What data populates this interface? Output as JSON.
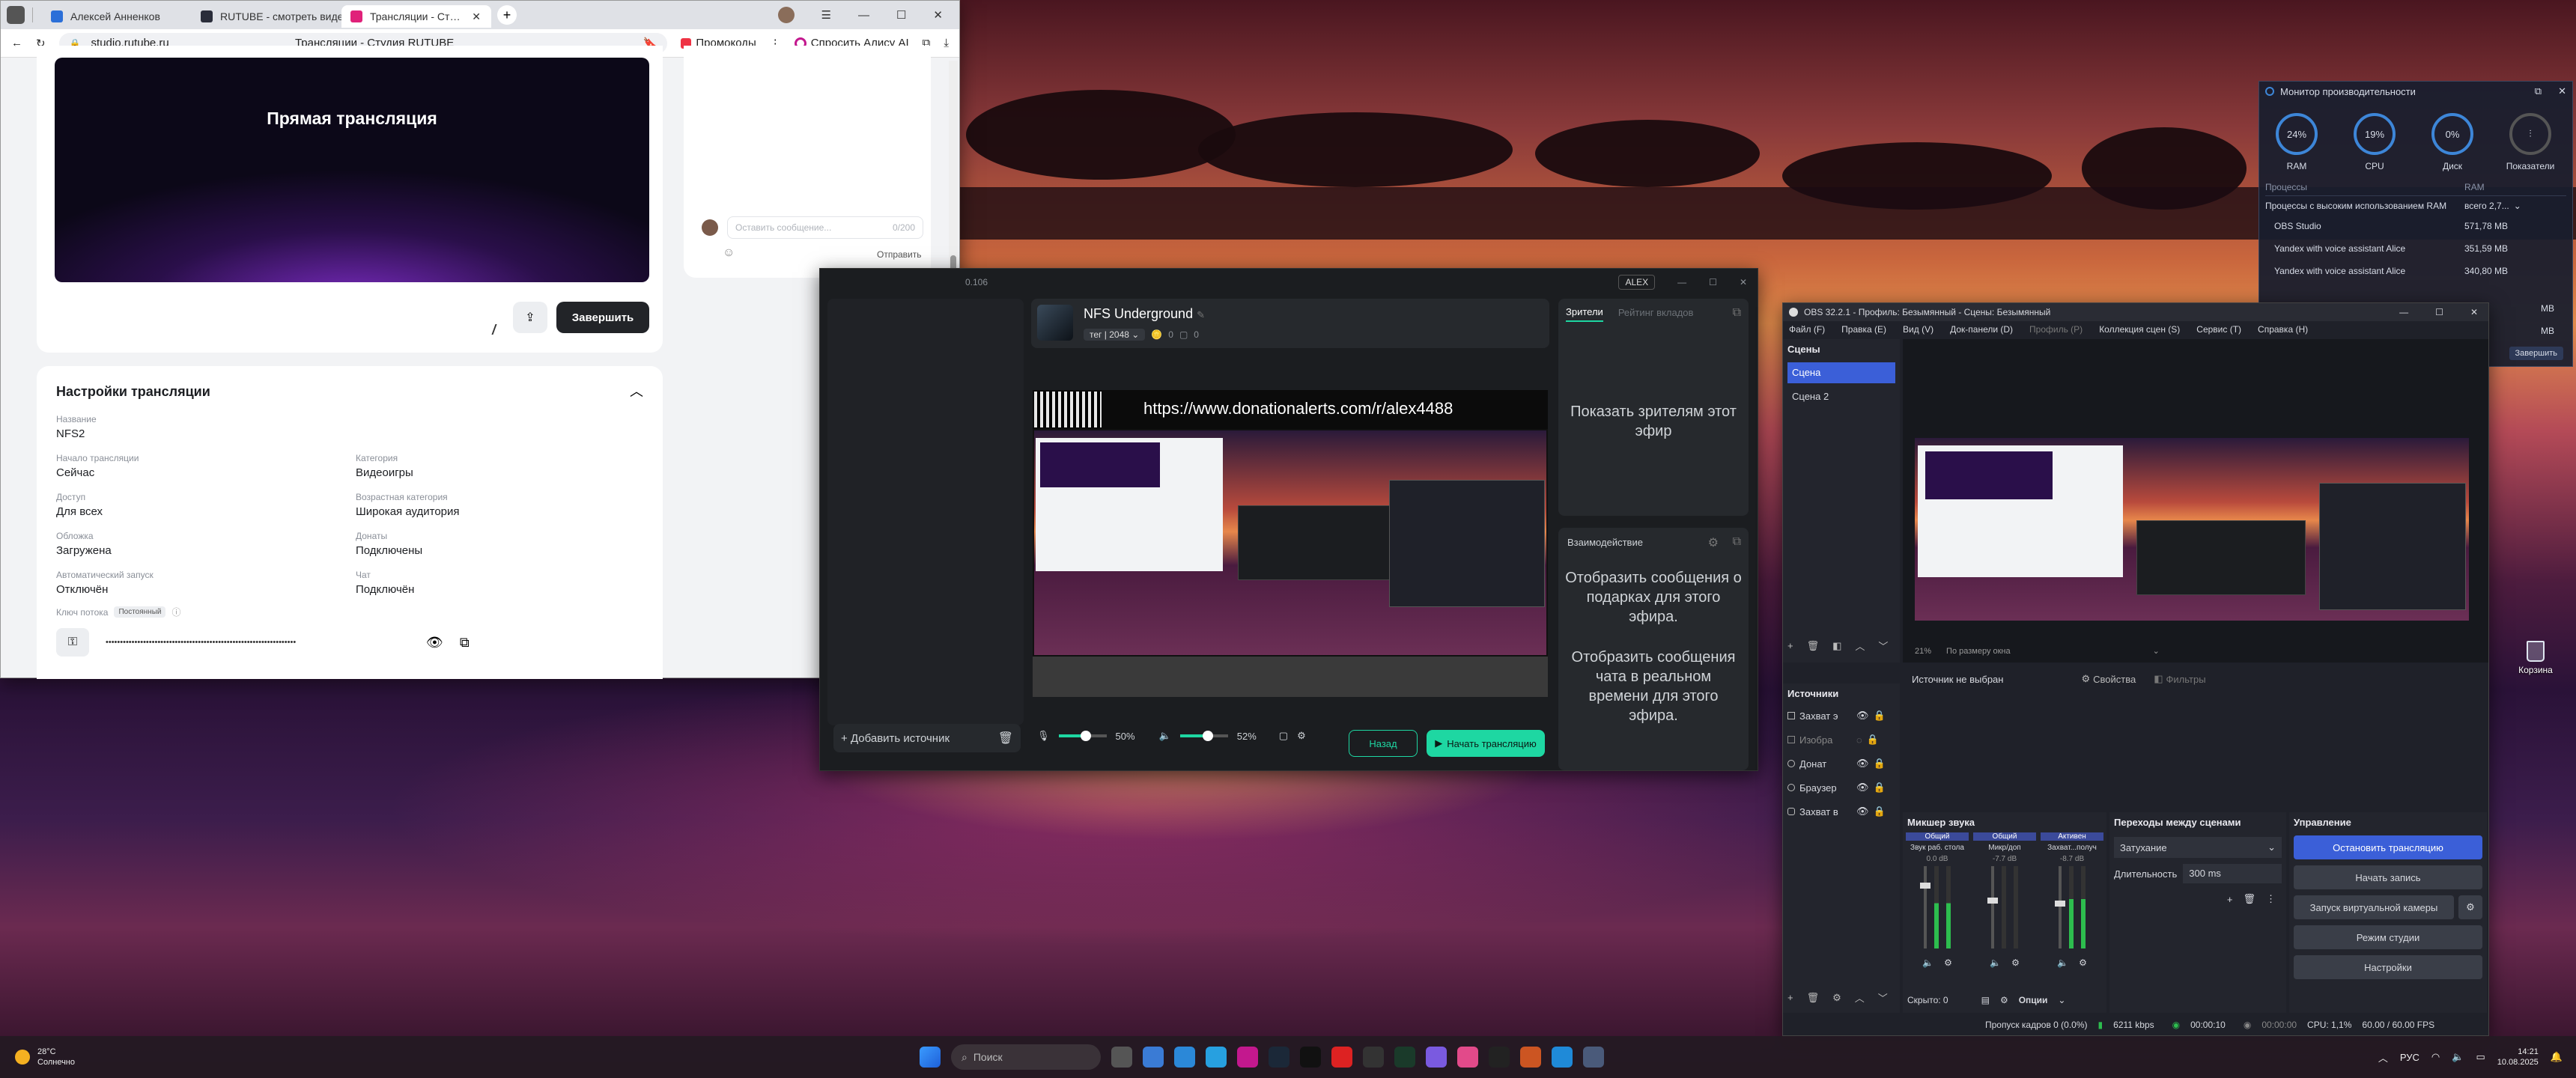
{
  "desktop": {
    "recycle_bin": "Корзина"
  },
  "browser": {
    "tabs": [
      {
        "label": "Алексей Анненков",
        "favicon_color": "#2b6fd8"
      },
      {
        "label": "RUTUBE - смотреть видео",
        "favicon_color": "#2a2d3a"
      },
      {
        "label": "Трансляции - Студия RUTUBE",
        "favicon_color": "#e0217a"
      }
    ],
    "url": "studio.rutube.ru",
    "page_title": "Трансляции - Студия RUTUBE",
    "promo_label": "Промокоды",
    "alice_label": "Спросить Алису AI",
    "preview_title": "Прямая трансляция",
    "finish_button": "Завершить",
    "settings": {
      "title": "Настройки трансляции",
      "name_label": "Название",
      "name_value": "NFS2",
      "start_label": "Начало трансляции",
      "start_value": "Сейчас",
      "category_label": "Категория",
      "category_value": "Видеоигры",
      "access_label": "Доступ",
      "access_value": "Для всех",
      "age_label": "Возрастная категория",
      "age_value": "Широкая аудитория",
      "cover_label": "Обложка",
      "cover_value": "Загружена",
      "donate_label": "Донаты",
      "donate_value": "Подключены",
      "autostart_label": "Автоматический запуск",
      "autostart_value": "Отключён",
      "chat_label": "Чат",
      "chat_value": "Подключён",
      "key_label": "Ключ потока",
      "key_badge": "Постоянный",
      "key_value": "••••••••••••••••••••••••••••••••••••••••••••••••••••••••••••••••••"
    },
    "chat": {
      "placeholder": "Оставить сообщение...",
      "counter": "0/200",
      "send": "Отправить"
    }
  },
  "studio": {
    "header_ip": "0.106",
    "user": "ALEX",
    "stream_title": "NFS Underground",
    "tag": "тег",
    "tag_count": "2048",
    "likes": "0",
    "comments": "0",
    "donation_url": "https://www.donationalerts.com/r/alex4488",
    "tabs": {
      "viewers": "Зрители",
      "rating": "Рейтинг вкладов"
    },
    "show_viewers": "Показать зрителям этот эфир",
    "interaction": "Взаимодействие",
    "gift_msg": "Отобразить сообщения о подарках для этого эфира.",
    "chat_msg": "Отобразить сообщения чата в реальном времени для этого эфира.",
    "add_source": "Добавить источник",
    "mic_pct": "50%",
    "vol_pct": "52%",
    "back": "Назад",
    "start": "Начать трансляцию"
  },
  "monitor": {
    "title": "Монитор производительности",
    "gauges": [
      {
        "value": "24%",
        "label": "RAM",
        "level": 0.24
      },
      {
        "value": "19%",
        "label": "CPU",
        "level": 0.19
      },
      {
        "value": "0%",
        "label": "Диск",
        "level": 0
      },
      {
        "value": "",
        "label": "Показатели",
        "level": 0
      }
    ],
    "col_proc": "Процессы",
    "col_ram": "RAM",
    "group": "Процессы с высоким использованием RAM",
    "group_total": "всего 2,7...",
    "rows": [
      {
        "name": "OBS Studio",
        "ram": "571,78 MB"
      },
      {
        "name": "Yandex with voice assistant Alice",
        "ram": "351,59 MB"
      },
      {
        "name": "Yandex with voice assistant Alice",
        "ram": "340,80 MB"
      }
    ],
    "extra_ram": [
      "MB",
      "MB"
    ],
    "finish": "Завершить"
  },
  "obs": {
    "title": "OBS 32.2.1 - Профиль: Безымянный - Сцены: Безымянный",
    "menu": [
      "Файл (F)",
      "Правка (E)",
      "Вид (V)",
      "Док-панели (D)",
      "Профиль (P)",
      "Коллекция сцен (S)",
      "Сервис (T)",
      "Справка (H)"
    ],
    "scenes_title": "Сцены",
    "scenes": [
      "Сцена",
      "Сцена 2"
    ],
    "sources_title": "Источники",
    "sources": [
      "Захват э",
      "Изобра",
      "Донат",
      "Браузер",
      "Захват в"
    ],
    "zoom": "21%",
    "zoom_mode": "По размеру окна",
    "no_source": "Источник не выбран",
    "props": "Свойства",
    "filters": "Фильтры",
    "mixer_title": "Микшер звука",
    "mixer_channels": [
      {
        "tag": "Общий",
        "name": "Звук раб. стола",
        "db": "0.0 dB",
        "level": 0.55
      },
      {
        "tag": "Общий",
        "name": "Микр/доп",
        "db": "-7.7 dB",
        "level": 0
      },
      {
        "tag": "Активен",
        "name": "Захват...получ",
        "db": "-8.7 dB",
        "level": 0.6
      }
    ],
    "hidden": "Скрыто: 0",
    "options": "Опции",
    "transitions_title": "Переходы между сценами",
    "transition": "Затухание",
    "duration_label": "Длительность",
    "duration": "300 ms",
    "controls_title": "Управление",
    "controls": [
      "Остановить трансляцию",
      "Начать запись",
      "Запуск виртуальной камеры",
      "Режим студии",
      "Настройки"
    ],
    "status": {
      "dropped": "Пропуск кадров 0 (0.0%)",
      "kbps": "6211 kbps",
      "stream_time": "00:00:10",
      "rec_time": "00:00:00",
      "cpu": "CPU: 1,1%",
      "fps": "60.00 / 60.00 FPS"
    }
  },
  "taskbar": {
    "temp": "28°C",
    "weather": "Солнечно",
    "search": "Поиск",
    "lang": "РУС",
    "time": "14:21",
    "date": "10.08.2025"
  }
}
